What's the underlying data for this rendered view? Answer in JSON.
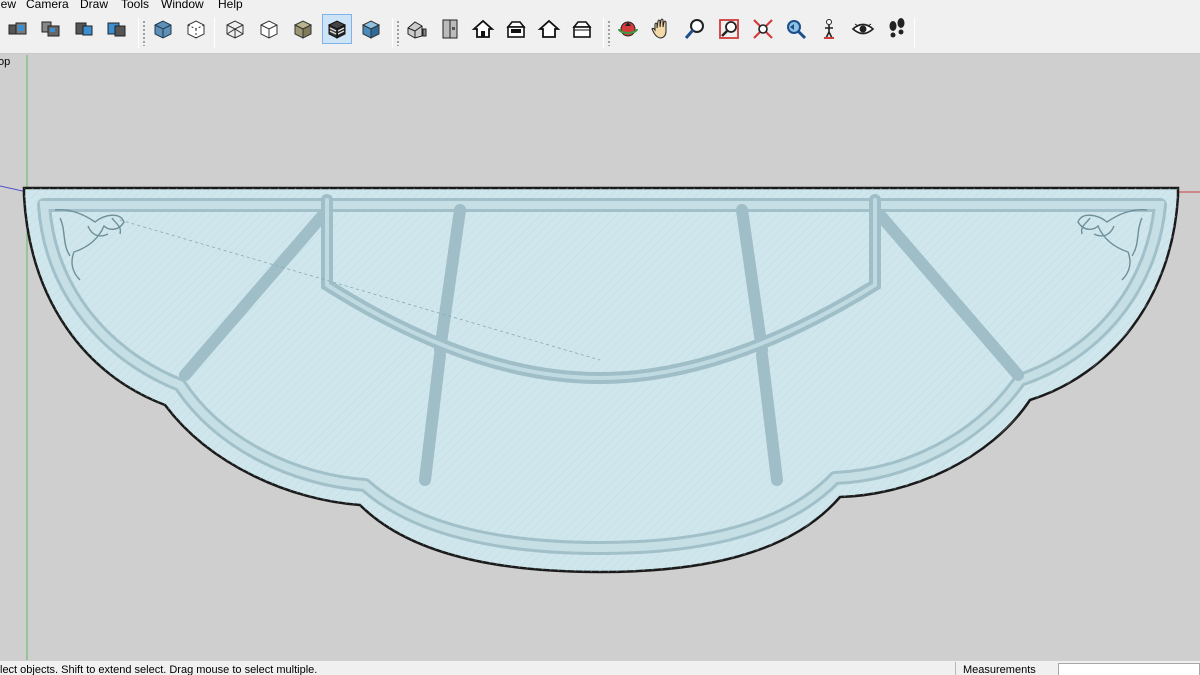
{
  "menubar": {
    "items": [
      {
        "label": "iew"
      },
      {
        "label": "Camera"
      },
      {
        "label": "Draw"
      },
      {
        "label": "Tools"
      },
      {
        "label": "Window"
      },
      {
        "label": "Help"
      }
    ]
  },
  "toolbar": {
    "groups": [
      {
        "name": "standard",
        "icons": [
          "components-icon",
          "groups-icon",
          "make-component-icon",
          "solid-tools-icon"
        ]
      },
      {
        "name": "styles",
        "icons": [
          "xray-icon",
          "back-edges-icon",
          "wireframe-icon",
          "hidden-line-icon",
          "shaded-icon",
          "shaded-textures-icon",
          "monochrome-icon"
        ],
        "active": "shaded-textures-icon"
      },
      {
        "name": "views",
        "icons": [
          "iso-view-icon",
          "top-view-icon",
          "front-view-icon",
          "right-view-icon",
          "back-view-icon",
          "left-view-icon"
        ]
      },
      {
        "name": "camera",
        "icons": [
          "orbit-icon",
          "pan-icon",
          "zoom-icon",
          "zoom-window-icon",
          "zoom-extents-icon",
          "previous-view-icon",
          "position-camera-icon",
          "look-around-icon",
          "walk-icon"
        ]
      }
    ]
  },
  "viewport": {
    "scene_label": "op",
    "colors": {
      "background": "#cfcfcf",
      "glass": "#cfe6ec",
      "frame": "#b7d2d9",
      "frame_edge": "#93b3bd",
      "outline": "#1a1a1a",
      "axis_green": "#62b462",
      "axis_red": "#d23c3c",
      "axis_blue": "#5050c8"
    }
  },
  "statusbar": {
    "text": "lect objects. Shift to extend select. Drag mouse to select multiple.",
    "measurements_label": "Measurements"
  }
}
